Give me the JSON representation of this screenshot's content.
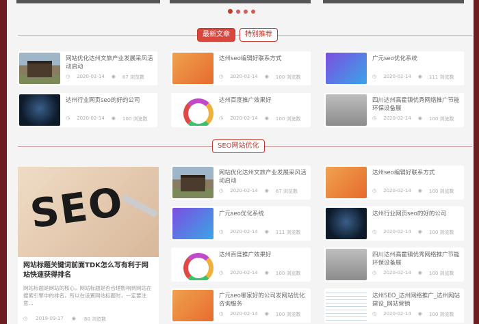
{
  "section1": {
    "tabs": [
      {
        "label": "最新文章",
        "active": true
      },
      {
        "label": "特别推荐",
        "active": false
      }
    ],
    "cards": [
      {
        "title": "网站优化达州文旅产业发展采风活动启动",
        "date": "2020-02-14",
        "views": "67 浏览数",
        "thumb": "arch"
      },
      {
        "title": "达州seo编辑好联系方式",
        "date": "2020-02-14",
        "views": "100 浏览数",
        "thumb": "orange"
      },
      {
        "title": "广元seo优化系统",
        "date": "2020-02-14",
        "views": "111 浏览数",
        "thumb": "purple"
      },
      {
        "title": "达州行业网页seo的好的公司",
        "date": "2020-02-14",
        "views": "100 浏览数",
        "thumb": "dark"
      },
      {
        "title": "达州百度推广效果好",
        "date": "2020-02-14",
        "views": "100 浏览数",
        "thumb": "wheel"
      },
      {
        "title": "四川达州高霍镇优秀网络推广节能环保设备展",
        "date": "2020-02-14",
        "views": "100 浏览数",
        "thumb": "fog"
      }
    ]
  },
  "section2": {
    "tab": "SEO网站优化",
    "feature": {
      "title": "网站标题关键词前面TDK怎么写有利于网站快速获得排名",
      "desc": "网站标题是网站的核心，网站标题是否合理影响到网站在搜索引擎中的排名，所以在设置网站标题时，一定要注意...",
      "date": "2019-09-17",
      "views": "80 浏览数"
    },
    "cards": [
      {
        "title": "网站优化达州文旅产业发展采风活动启动",
        "date": "2020-02-14",
        "views": "67 浏览数",
        "thumb": "arch"
      },
      {
        "title": "达州seo编辑好联系方式",
        "date": "2020-02-14",
        "views": "100 浏览数",
        "thumb": "orange"
      },
      {
        "title": "广元seo优化系统",
        "date": "2020-02-14",
        "views": "111 浏览数",
        "thumb": "purple"
      },
      {
        "title": "达州行业网页seo的好的公司",
        "date": "2020-02-14",
        "views": "100 浏览数",
        "thumb": "dark"
      },
      {
        "title": "达州百度推广效果好",
        "date": "2020-02-14",
        "views": "100 浏览数",
        "thumb": "wheel"
      },
      {
        "title": "四川达州高霍镇优秀网络推广节能环保设备展",
        "date": "2020-02-14",
        "views": "100 浏览数",
        "thumb": "fog"
      },
      {
        "title": "广元seo哪家好的公司发网站优化咨询服务",
        "date": "2020-02-14",
        "views": "100 浏览数",
        "thumb": "orange"
      },
      {
        "title": "达州SEO_达州网络推广_达州网站建设_网站营销",
        "date": "2020-02-14",
        "views": "100 浏览数",
        "thumb": "sheet"
      }
    ]
  },
  "colors": {
    "accent": "#d9463e",
    "frame": "#6b1f22"
  }
}
